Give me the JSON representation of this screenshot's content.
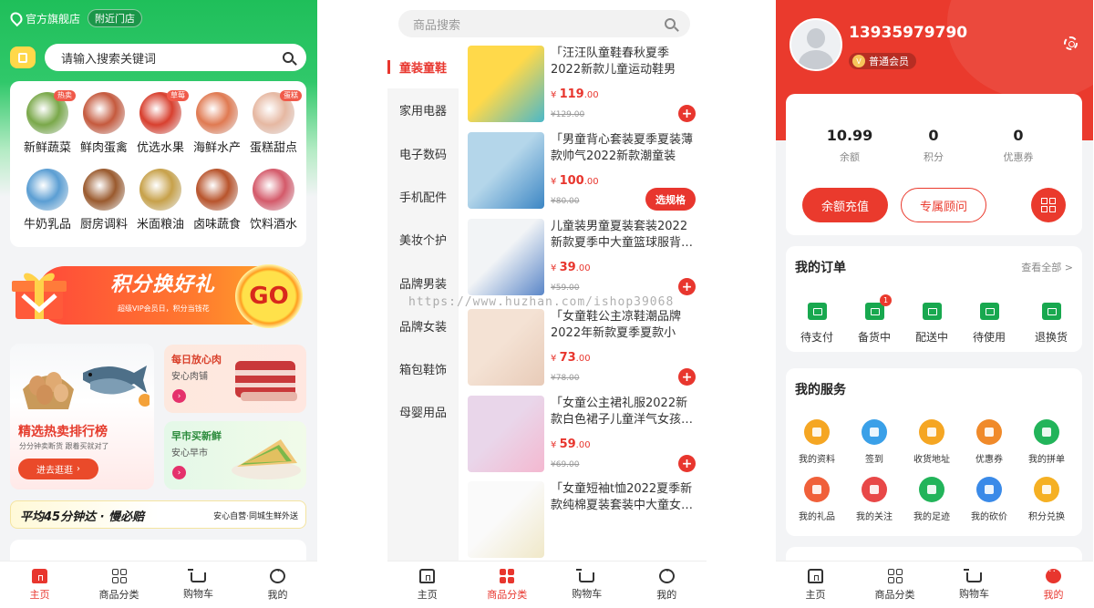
{
  "screens": {
    "home": {
      "store_label": "官方旗舰店",
      "nearby_label": "附近门店",
      "search_placeholder": "请输入搜索关键词",
      "categories": [
        {
          "label": "新鲜蔬菜",
          "tag": "热卖",
          "color": "#7aa84a"
        },
        {
          "label": "鲜肉蛋禽",
          "tag": "",
          "color": "#c55a3e"
        },
        {
          "label": "优选水果",
          "tag": "草莓",
          "color": "#d8402f"
        },
        {
          "label": "海鲜水产",
          "tag": "",
          "color": "#e07a52"
        },
        {
          "label": "蛋糕甜点",
          "tag": "蛋糕",
          "color": "#e6b8a2"
        },
        {
          "label": "牛奶乳品",
          "tag": "",
          "color": "#5b9ed3"
        },
        {
          "label": "厨房调料",
          "tag": "",
          "color": "#9a5a2e"
        },
        {
          "label": "米面粮油",
          "tag": "",
          "color": "#c7a14a"
        },
        {
          "label": "卤味蔬食",
          "tag": "",
          "color": "#b8542c"
        },
        {
          "label": "饮料酒水",
          "tag": "",
          "color": "#d45a6a"
        }
      ],
      "banner": {
        "title": "积分换好礼",
        "subtitle": "超级VIP会员日，积分当钱花",
        "go": "GO"
      },
      "promo_left": {
        "title": "精选热卖排行榜",
        "subtitle": "分分钟卖断货 跟着买就对了",
        "button": "进去逛逛"
      },
      "promo_right": [
        {
          "title": "每日放心肉",
          "subtitle": "安心肉铺",
          "title_color": "#d9402a"
        },
        {
          "title": "早市买新鲜",
          "subtitle": "安心早市",
          "title_color": "#2a8a3a"
        }
      ],
      "delivery": {
        "main": "平均45分钟达 · 慢必赔",
        "side": "安心自营·同城生鲜外送"
      }
    },
    "category": {
      "search_placeholder": "商品搜索",
      "sidebar": [
        "童装童鞋",
        "家用电器",
        "电子数码",
        "手机配件",
        "美妆个护",
        "品牌男装",
        "品牌女装",
        "箱包鞋饰",
        "母婴用品"
      ],
      "active_index": 0,
      "watermark": "https://www.huzhan.com/ishop39068",
      "products": [
        {
          "name": "「汪汪队童鞋春秋夏季2022新款儿童运动鞋男小…",
          "currency": "¥",
          "price_int": "119",
          "price_dec": ".00",
          "old": "¥129.00",
          "action": "+",
          "colors": [
            "#ffd94a",
            "#4bb8c9"
          ]
        },
        {
          "name": "「男童背心套装夏季夏装薄款帅气2022新款潮童装洋…",
          "currency": "¥",
          "price_int": "100",
          "price_dec": ".00",
          "old": "¥80.00",
          "action": "选规格",
          "colors": [
            "#b4d6ea",
            "#3c86c4"
          ]
        },
        {
          "name": "儿童装男童夏装套装2022新款夏季中大童篮球服背…",
          "currency": "¥",
          "price_int": "39",
          "price_dec": ".00",
          "old": "¥59.00",
          "action": "+",
          "colors": [
            "#f2f4f6",
            "#5a86c8"
          ]
        },
        {
          "name": "「女童鞋公主凉鞋潮品牌2022年新款夏季夏款小童…",
          "currency": "¥",
          "price_int": "73",
          "price_dec": ".00",
          "old": "¥78.00",
          "action": "+",
          "colors": [
            "#f4e2d4",
            "#e8cbb8"
          ]
        },
        {
          "name": "「女童公主裙礼服2022新款白色裙子儿童洋气女孩…",
          "currency": "¥",
          "price_int": "59",
          "price_dec": ".00",
          "old": "¥69.00",
          "action": "+",
          "colors": [
            "#e9d6ea",
            "#f4b8d0"
          ]
        },
        {
          "name": "「女童短袖t恤2022夏季新款纯棉夏装套装中大童女…",
          "currency": "",
          "price_int": "",
          "price_dec": "",
          "old": "",
          "action": "",
          "colors": [
            "#fafafa",
            "#f0e8c8"
          ]
        }
      ]
    },
    "profile": {
      "phone": "13935979790",
      "member_label": "普通会员",
      "member_icon": "V",
      "assets": [
        {
          "value": "10.99",
          "label": "余额"
        },
        {
          "value": "0",
          "label": "积分"
        },
        {
          "value": "0",
          "label": "优惠券"
        }
      ],
      "topup_button": "余额充值",
      "advisor_button": "专属顾问",
      "orders": {
        "title": "我的订单",
        "more": "查看全部 >",
        "items": [
          {
            "label": "待支付",
            "badge": ""
          },
          {
            "label": "备货中",
            "badge": "1"
          },
          {
            "label": "配送中",
            "badge": ""
          },
          {
            "label": "待使用",
            "badge": ""
          },
          {
            "label": "退换货",
            "badge": ""
          }
        ]
      },
      "services": {
        "title": "我的服务",
        "items": [
          {
            "label": "我的资料",
            "color": "#f5a623"
          },
          {
            "label": "签到",
            "color": "#3aa0e8"
          },
          {
            "label": "收货地址",
            "color": "#f5a623"
          },
          {
            "label": "优惠券",
            "color": "#f08a2a"
          },
          {
            "label": "我的拼单",
            "color": "#22b45a"
          },
          {
            "label": "我的礼品",
            "color": "#f0603a"
          },
          {
            "label": "我的关注",
            "color": "#e84848"
          },
          {
            "label": "我的足迹",
            "color": "#22b45a"
          },
          {
            "label": "我的砍价",
            "color": "#3a8ae8"
          },
          {
            "label": "积分兑换",
            "color": "#f5b023"
          }
        ]
      }
    }
  },
  "tabbar": [
    "主页",
    "商品分类",
    "购物车",
    "我的"
  ],
  "accent": "#e8362e"
}
